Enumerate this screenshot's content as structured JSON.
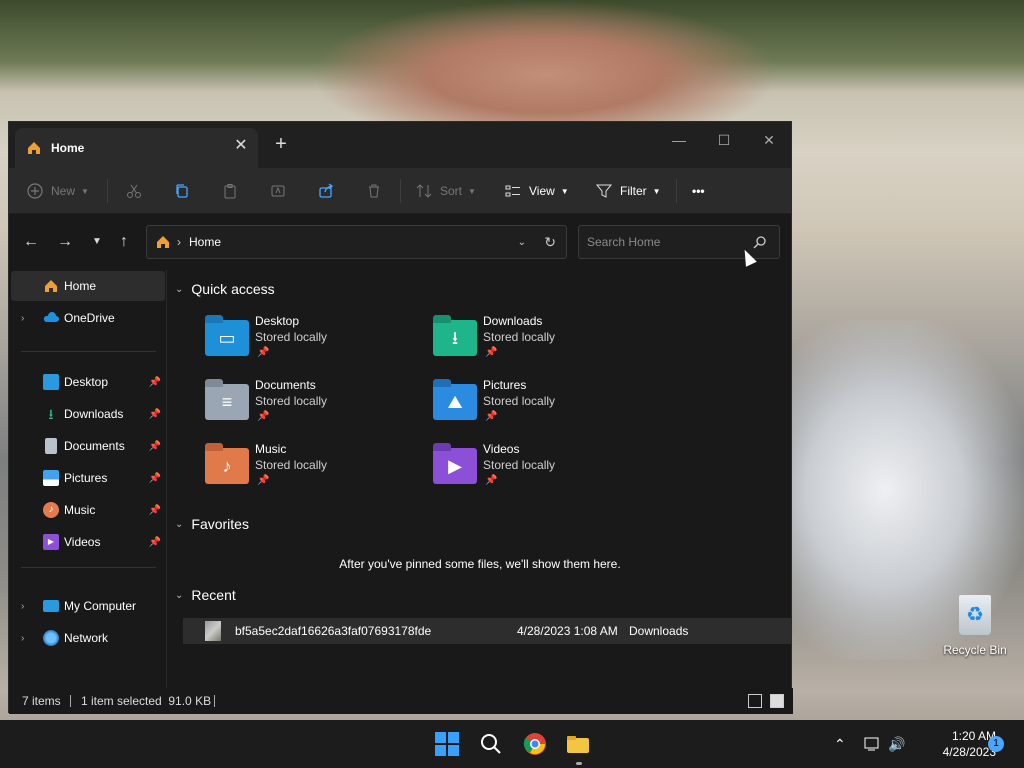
{
  "window": {
    "tab_title": "Home",
    "tab_close": "✕",
    "new_tab": "+",
    "minimize": "—",
    "maximize": "☐",
    "close": "✕"
  },
  "toolbar": {
    "new_label": "New",
    "sort_label": "Sort",
    "view_label": "View",
    "filter_label": "Filter",
    "more": "•••"
  },
  "address": {
    "crumb": "Home",
    "search_placeholder": "Search Home"
  },
  "sidebar": {
    "items": [
      {
        "label": "Home"
      },
      {
        "label": "OneDrive"
      },
      {
        "label": "Desktop"
      },
      {
        "label": "Downloads"
      },
      {
        "label": "Documents"
      },
      {
        "label": "Pictures"
      },
      {
        "label": "Music"
      },
      {
        "label": "Videos"
      },
      {
        "label": "My Computer"
      },
      {
        "label": "Network"
      }
    ]
  },
  "content": {
    "quick_access_title": "Quick access",
    "favorites_title": "Favorites",
    "recent_title": "Recent",
    "favorites_message": "After you've pinned some files, we'll show them here.",
    "quick_access": [
      {
        "name": "Desktop",
        "sub": "Stored locally",
        "color": "#1e90d8"
      },
      {
        "name": "Downloads",
        "sub": "Stored locally",
        "color": "#1fb58a"
      },
      {
        "name": "Documents",
        "sub": "Stored locally",
        "color": "#9aa6b4"
      },
      {
        "name": "Pictures",
        "sub": "Stored locally",
        "color": "#2a8be0"
      },
      {
        "name": "Music",
        "sub": "Stored locally",
        "color": "#e07a4a"
      },
      {
        "name": "Videos",
        "sub": "Stored locally",
        "color": "#8b4fd8"
      }
    ],
    "recent": [
      {
        "name": "bf5a5ec2daf16626a3faf07693178fde",
        "date": "4/28/2023 1:08 AM",
        "location": "Downloads"
      }
    ]
  },
  "status": {
    "items": "7 items",
    "selected": "1 item selected  91.0 KB"
  },
  "desktop": {
    "recycle_bin": "Recycle Bin"
  },
  "taskbar": {
    "time": "1:20 AM",
    "date": "4/28/2023",
    "notifications": "1"
  }
}
